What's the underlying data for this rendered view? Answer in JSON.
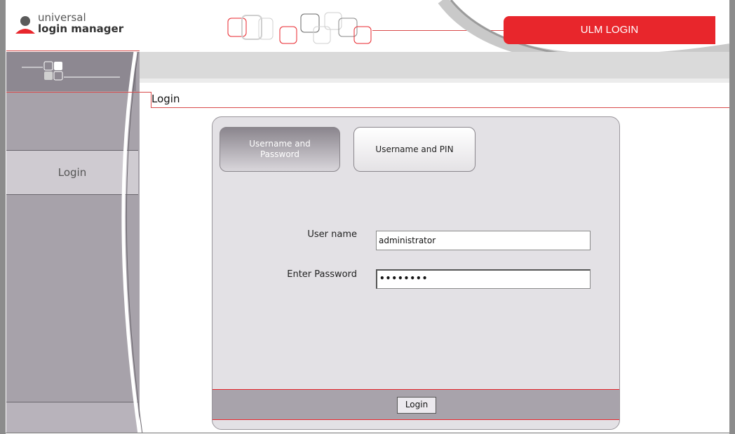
{
  "app": {
    "logo_line1": "universal",
    "logo_line2": "login manager",
    "banner": "ULM LOGIN"
  },
  "sidebar": {
    "items": [
      {
        "label": "Login"
      }
    ]
  },
  "page": {
    "heading": "Login"
  },
  "login_panel": {
    "tabs": [
      {
        "label": "Username and Password",
        "active": true
      },
      {
        "label": "Username and PIN",
        "active": false
      }
    ],
    "username": {
      "label": "User name",
      "value": "administrator"
    },
    "password": {
      "label": "Enter Password",
      "masked_value": "••••••••"
    },
    "submit_label": "Login"
  },
  "colors": {
    "accent": "#e8262c",
    "sidebar": "#a7a2aa",
    "panel": "#e3e1e5"
  }
}
